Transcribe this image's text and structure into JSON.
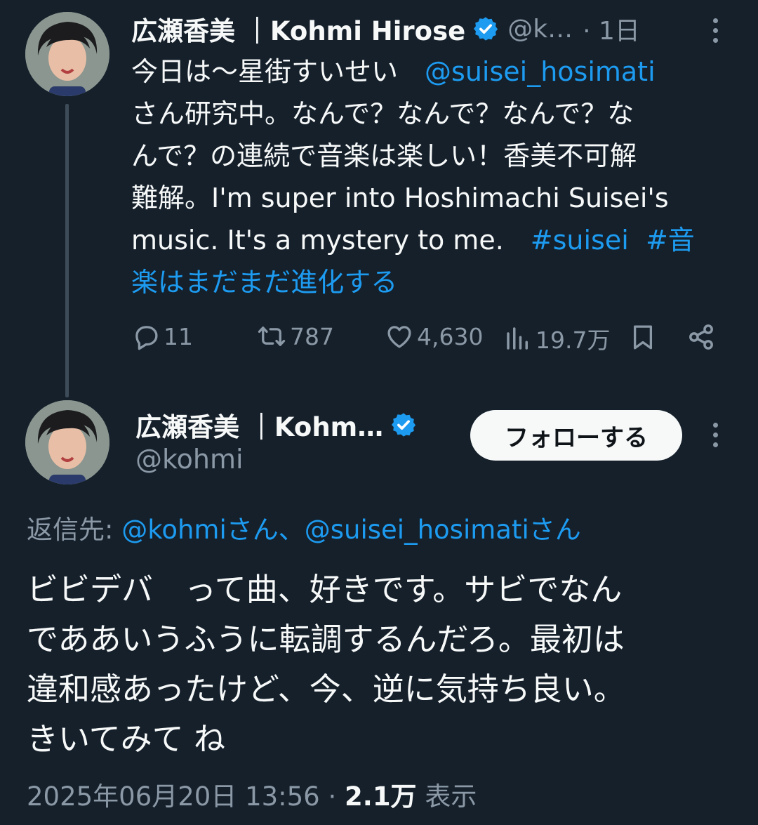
{
  "tweet1": {
    "author_name": "広瀬香美 ｜Kohmi Hirose",
    "handle_truncated": "@k…",
    "time": "· 1日",
    "body": {
      "line1_text": "今日は〜星街すいせい　",
      "line1_mention": "@suisei_hosimati",
      "line2": "さん研究中。なんで？なんで？なんで？な",
      "line3": "んで？の連続で音楽は楽しい！香美不可解",
      "line4": "難解。I'm super into Hoshimachi Suisei's",
      "line5_text": "music. It's a mystery to me.　",
      "hashtag1": "#suisei",
      "hashtag2_part1": "#音",
      "hashtag2_part2": "楽はまだまだ進化する"
    },
    "actions": {
      "replies": "11",
      "reposts": "787",
      "likes": "4,630",
      "views": "19.7万"
    }
  },
  "tweet2": {
    "author_name": "広瀬香美 ｜Kohm…",
    "handle": "@kohmi",
    "follow_label": "フォローする",
    "reply_prefix": "返信先: ",
    "reply_targets": "@kohmiさん、@suisei_hosimatiさん",
    "body_lines": [
      "ビビデバ　って曲、好きです。サビでなん",
      "でああいうふうに転調するんだろ。最初は",
      "違和感あったけど、今、逆に気持ち良い。",
      "きいてみて ね"
    ],
    "timestamp": "2025年06月20日 13:56",
    "separator": " · ",
    "views_count": "2.1万",
    "views_label": " 表示"
  },
  "colors": {
    "background": "#15202b",
    "text": "#f7f9f9",
    "muted": "#8b98a5",
    "link": "#1d9bf0",
    "verified": "#1d9bf0"
  },
  "icons": {
    "reply": "speech-bubble-icon",
    "repost": "repost-arrows-icon",
    "like": "heart-icon",
    "views": "bar-chart-icon",
    "bookmark": "bookmark-icon",
    "share": "share-icon",
    "more": "vertical-dots-icon",
    "verified": "verified-badge-icon"
  }
}
